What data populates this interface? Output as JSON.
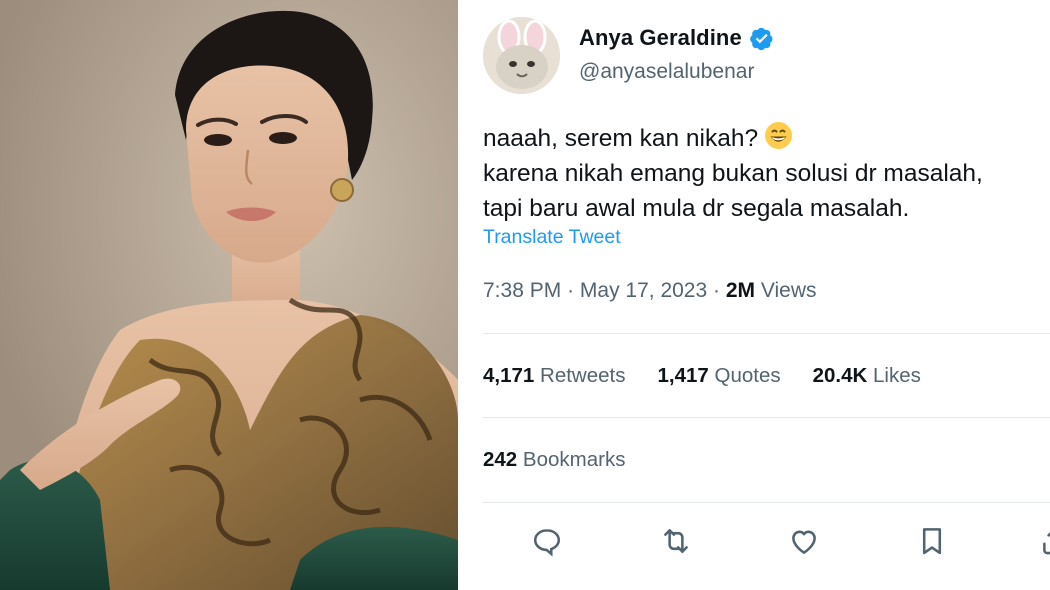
{
  "tweet": {
    "author": {
      "display_name": "Anya Geraldine",
      "handle": "@anyaselalubenar",
      "verified": true
    },
    "text_lines": [
      "naaah, serem kan nikah?",
      "karena nikah emang bukan solusi dr masalah,",
      "tapi baru awal mula dr segala masalah."
    ],
    "emoji": "smiling-face-with-open-mouth",
    "translate_label": "Translate Tweet",
    "time": "7:38 PM",
    "separator": "·",
    "date": "May 17, 2023",
    "views_count": "2M",
    "views_label": "Views",
    "retweets_count": "4,171",
    "retweets_label": "Retweets",
    "quotes_count": "1,417",
    "quotes_label": "Quotes",
    "likes_count": "20.4K",
    "likes_label": "Likes",
    "bookmarks_count": "242",
    "bookmarks_label": "Bookmarks"
  },
  "actions": [
    "reply-icon",
    "retweet-icon",
    "like-icon",
    "bookmark-icon",
    "share-icon"
  ],
  "colors": {
    "text": "#0f1419",
    "secondary": "#536471",
    "link": "#1d9bf0",
    "verified": "#1d9bf0",
    "divider": "#e4e8eb"
  }
}
